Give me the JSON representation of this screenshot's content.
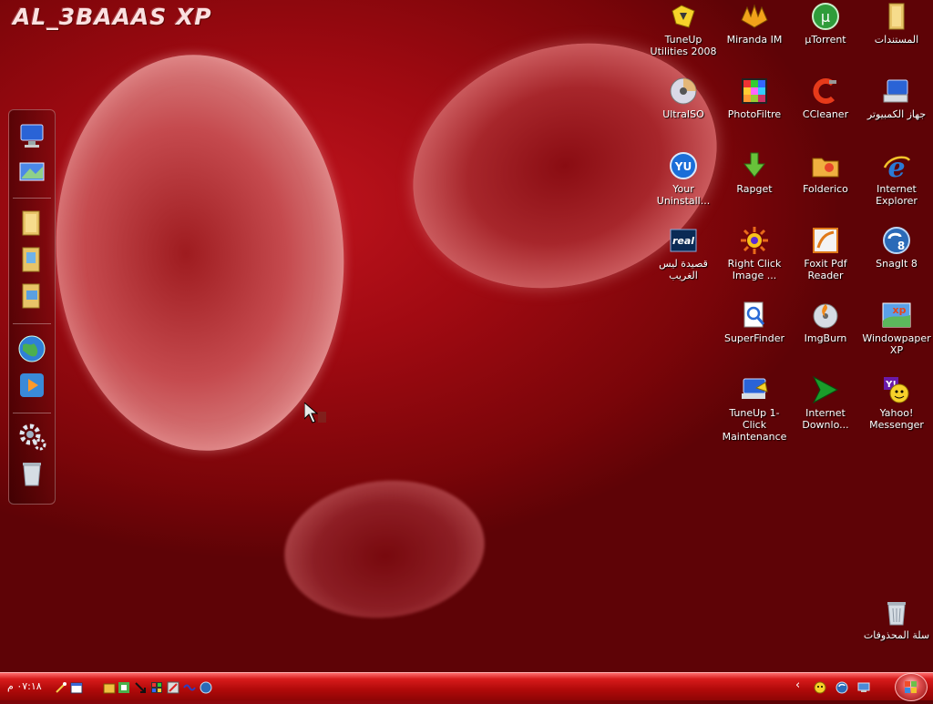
{
  "brand_title": "AL_3BAAAS XP",
  "desktop_icons": {
    "c1r1": "TuneUp Utilities 2008",
    "c2r1": "Miranda IM",
    "c3r1": "µTorrent",
    "c4r1": "المستندات",
    "c1r2": "UltraISO",
    "c2r2": "PhotoFiltre",
    "c3r2": "CCleaner",
    "c4r2": "جهاز الكمبيوتر",
    "c1r3": "Your Uninstall...",
    "c2r3": "Rapget",
    "c3r3": "Folderico",
    "c4r3": "Internet Explorer",
    "c1r4": "قصيدة ليس الغريب",
    "c2r4": "Right Click Image ...",
    "c3r4": "Foxit Pdf Reader",
    "c4r4": "SnagIt 8",
    "c2r5": "SuperFinder",
    "c3r5": "ImgBurn",
    "c4r5": "Windowpaper XP",
    "c2r6": "TuneUp 1-Click Maintenance",
    "c3r6": "Internet Downlo...",
    "c4r6": "Yahoo! Messenger",
    "recycle": "سلة المحذوفات"
  },
  "taskbar": {
    "clock": "٠٧:١٨ م",
    "tray_chevron": "‹"
  },
  "colors": {
    "desktop_bg": "#a10a12",
    "taskbar": "#c01010"
  }
}
